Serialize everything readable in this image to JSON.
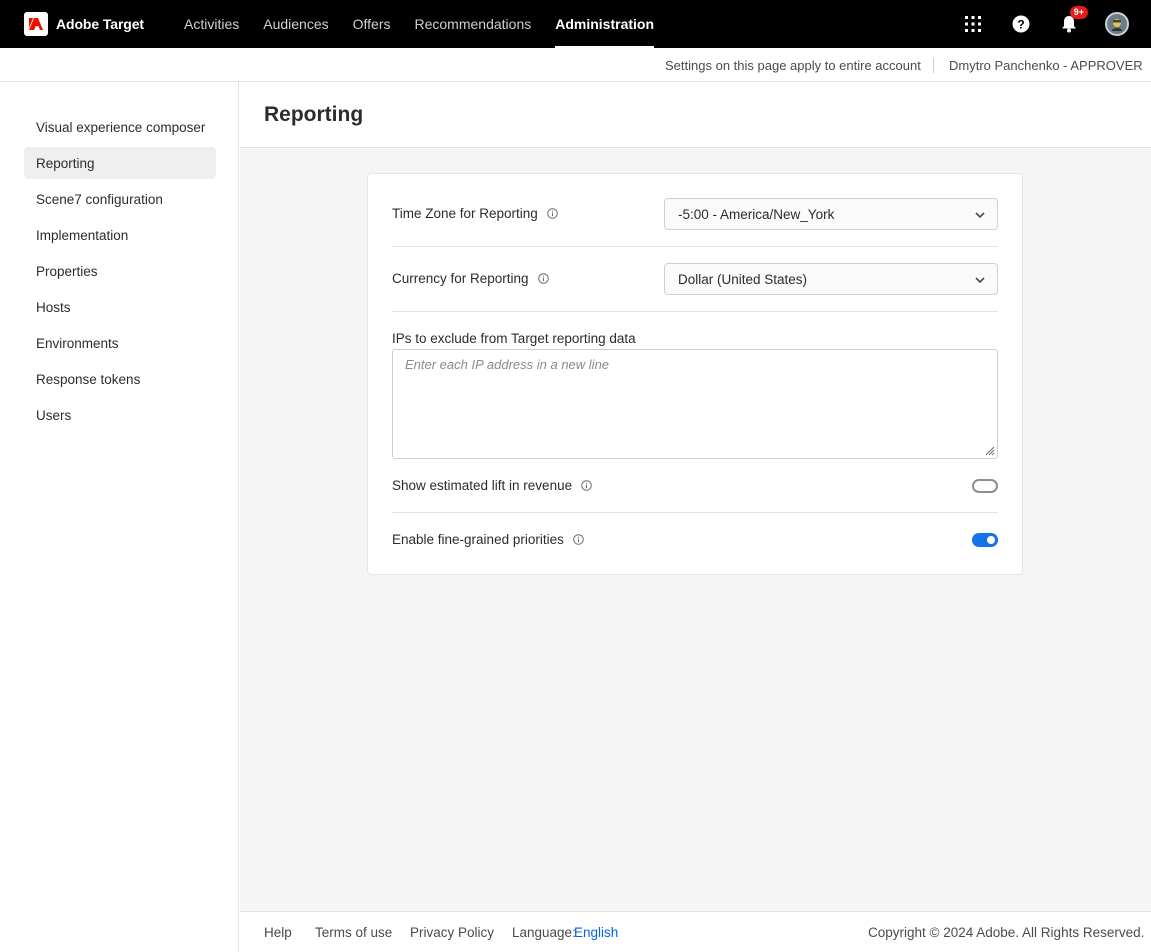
{
  "app": {
    "name": "Adobe Target"
  },
  "nav": {
    "items": [
      {
        "label": "Activities"
      },
      {
        "label": "Audiences"
      },
      {
        "label": "Offers"
      },
      {
        "label": "Recommendations"
      },
      {
        "label": "Administration"
      }
    ],
    "active": "Administration",
    "notification_badge": "9+"
  },
  "subbar": {
    "scope_text": "Settings on this page apply to entire account",
    "user_text": "Dmytro Panchenko - APPROVER"
  },
  "sidebar": {
    "items": [
      {
        "label": "Visual experience composer"
      },
      {
        "label": "Reporting"
      },
      {
        "label": "Scene7 configuration"
      },
      {
        "label": "Implementation"
      },
      {
        "label": "Properties"
      },
      {
        "label": "Hosts"
      },
      {
        "label": "Environments"
      },
      {
        "label": "Response tokens"
      },
      {
        "label": "Users"
      }
    ],
    "selected": "Reporting"
  },
  "page": {
    "title": "Reporting"
  },
  "settings": {
    "timezone": {
      "label": "Time Zone for Reporting",
      "value": "-5:00 - America/New_York"
    },
    "currency": {
      "label": "Currency for Reporting",
      "value": "Dollar (United States)"
    },
    "ips": {
      "label": "IPs to exclude from Target reporting data",
      "placeholder": "Enter each IP address in a new line",
      "value": ""
    },
    "lift": {
      "label": "Show estimated lift in revenue",
      "enabled": false
    },
    "priorities": {
      "label": "Enable fine-grained priorities",
      "enabled": true
    }
  },
  "footer": {
    "help": "Help",
    "terms": "Terms of use",
    "privacy": "Privacy Policy",
    "language_label": "Language:",
    "language_value": "English",
    "copyright": "Copyright © 2024 Adobe. All Rights Reserved."
  },
  "colors": {
    "accent": "#1473e6",
    "link": "#0265dc",
    "nav_bg": "#000000",
    "badge": "#e31b1b"
  }
}
